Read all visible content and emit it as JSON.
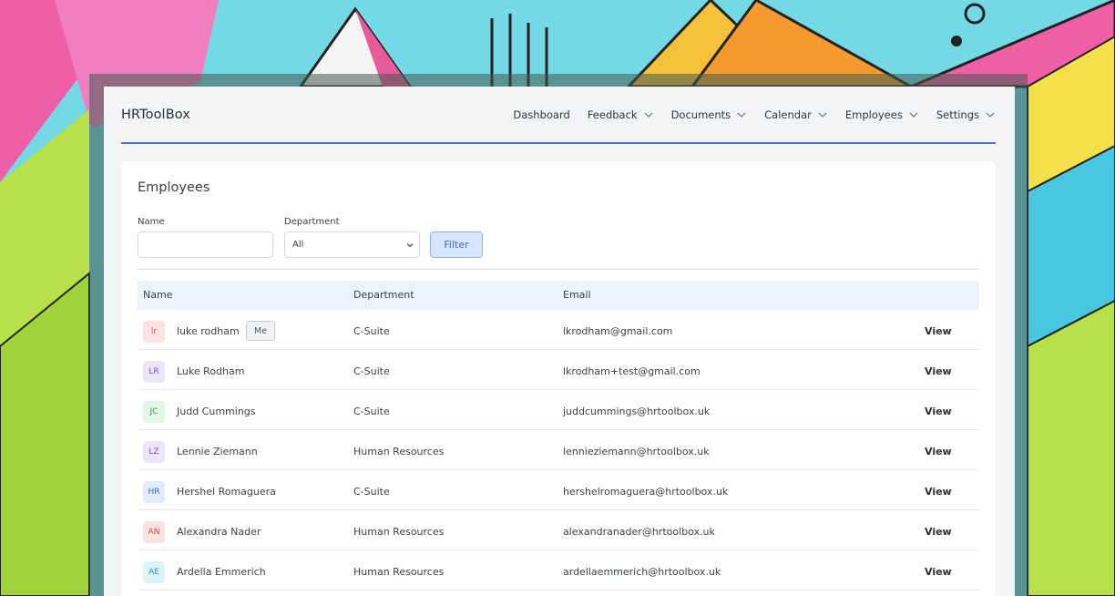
{
  "navbar": {
    "brand": "HRToolBox",
    "items": [
      {
        "label": "Dashboard",
        "dropdown": false
      },
      {
        "label": "Feedback",
        "dropdown": true
      },
      {
        "label": "Documents",
        "dropdown": true
      },
      {
        "label": "Calendar",
        "dropdown": true
      },
      {
        "label": "Employees",
        "dropdown": true
      },
      {
        "label": "Settings",
        "dropdown": true
      }
    ],
    "accent_color": "#4f6fd6"
  },
  "employees": {
    "title": "Employees",
    "filters": {
      "name_label": "Name",
      "name_value": "",
      "department_label": "Department",
      "department_value": "All",
      "filter_button": "Filter"
    },
    "columns": [
      "Name",
      "Department",
      "Email"
    ],
    "rows": [
      {
        "initials": "lr",
        "name": "luke rodham",
        "badge": "Me",
        "department": "C-Suite",
        "email": "lkrodham@gmail.com",
        "action": "View",
        "avatar_bg": "#fde2e2",
        "avatar_fg": "#c0504d"
      },
      {
        "initials": "LR",
        "name": "Luke Rodham",
        "badge": "",
        "department": "C-Suite",
        "email": "lkrodham+test@gmail.com",
        "action": "View",
        "avatar_bg": "#ece6fb",
        "avatar_fg": "#6a55b8"
      },
      {
        "initials": "JC",
        "name": "Judd Cummings",
        "badge": "",
        "department": "C-Suite",
        "email": "juddcummings@hrtoolbox.uk",
        "action": "View",
        "avatar_bg": "#e0f6e6",
        "avatar_fg": "#3d8a55"
      },
      {
        "initials": "LZ",
        "name": "Lennie Ziemann",
        "badge": "",
        "department": "Human Resources",
        "email": "lennieziemann@hrtoolbox.uk",
        "action": "View",
        "avatar_bg": "#ece6fb",
        "avatar_fg": "#6a55b8"
      },
      {
        "initials": "HR",
        "name": "Hershel Romaguera",
        "badge": "",
        "department": "C-Suite",
        "email": "hershelromaguera@hrtoolbox.uk",
        "action": "View",
        "avatar_bg": "#e1ecfc",
        "avatar_fg": "#3d66c9"
      },
      {
        "initials": "AN",
        "name": "Alexandra Nader",
        "badge": "",
        "department": "Human Resources",
        "email": "alexandranader@hrtoolbox.uk",
        "action": "View",
        "avatar_bg": "#fde2e2",
        "avatar_fg": "#c0504d"
      },
      {
        "initials": "AE",
        "name": "Ardella Emmerich",
        "badge": "",
        "department": "Human Resources",
        "email": "ardellaemmerich@hrtoolbox.uk",
        "action": "View",
        "avatar_bg": "#dcf4f8",
        "avatar_fg": "#2f8fa3"
      }
    ]
  }
}
